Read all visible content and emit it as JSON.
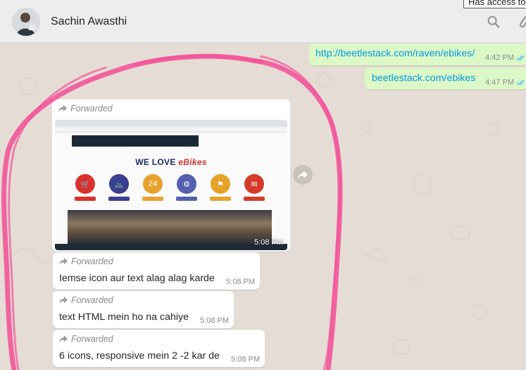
{
  "colors": {
    "chat_background": "#e5ddd5",
    "outgoing_bubble": "#dcf8c6",
    "incoming_bubble": "#ffffff",
    "link": "#039be5",
    "read_ticks": "#4fc3f7",
    "annotation_scribble": "#f2559a"
  },
  "header": {
    "contact_name": "Sachin Awasthi",
    "tooltip": "Has access to",
    "icons": [
      "avatar",
      "search-icon",
      "attach-icon"
    ]
  },
  "messages": [
    {
      "type": "outgoing",
      "text": "http://beetlestack.com/raven/ebikes/",
      "time": "4:42 PM",
      "ticks": "double-check-read"
    },
    {
      "type": "outgoing",
      "text": "beetlestack.com/ebikes",
      "time": "4:47 PM",
      "ticks": "double-check-read"
    },
    {
      "type": "incoming-image",
      "forwarded_label": "Forwarded",
      "time": "5:08 PM",
      "image": {
        "title_prefix": "WE LOVE ",
        "title_brand": "eBikes",
        "icon_colors": [
          "#d9322c",
          "#3b3f8f",
          "#e8a22d",
          "#5560b0",
          "#e5a428",
          "#d63a2a"
        ]
      }
    },
    {
      "type": "incoming",
      "forwarded_label": "Forwarded",
      "text": "Iemse icon aur text alag alag karde",
      "time": "5:08 PM"
    },
    {
      "type": "incoming",
      "forwarded_label": "Forwarded",
      "text": "text HTML mein ho na cahiye",
      "time": "5:08 PM"
    },
    {
      "type": "incoming",
      "forwarded_label": "Forwarded",
      "text": "6 icons, responsive mein 2 -2 kar de",
      "time": "5:08 PM"
    }
  ]
}
